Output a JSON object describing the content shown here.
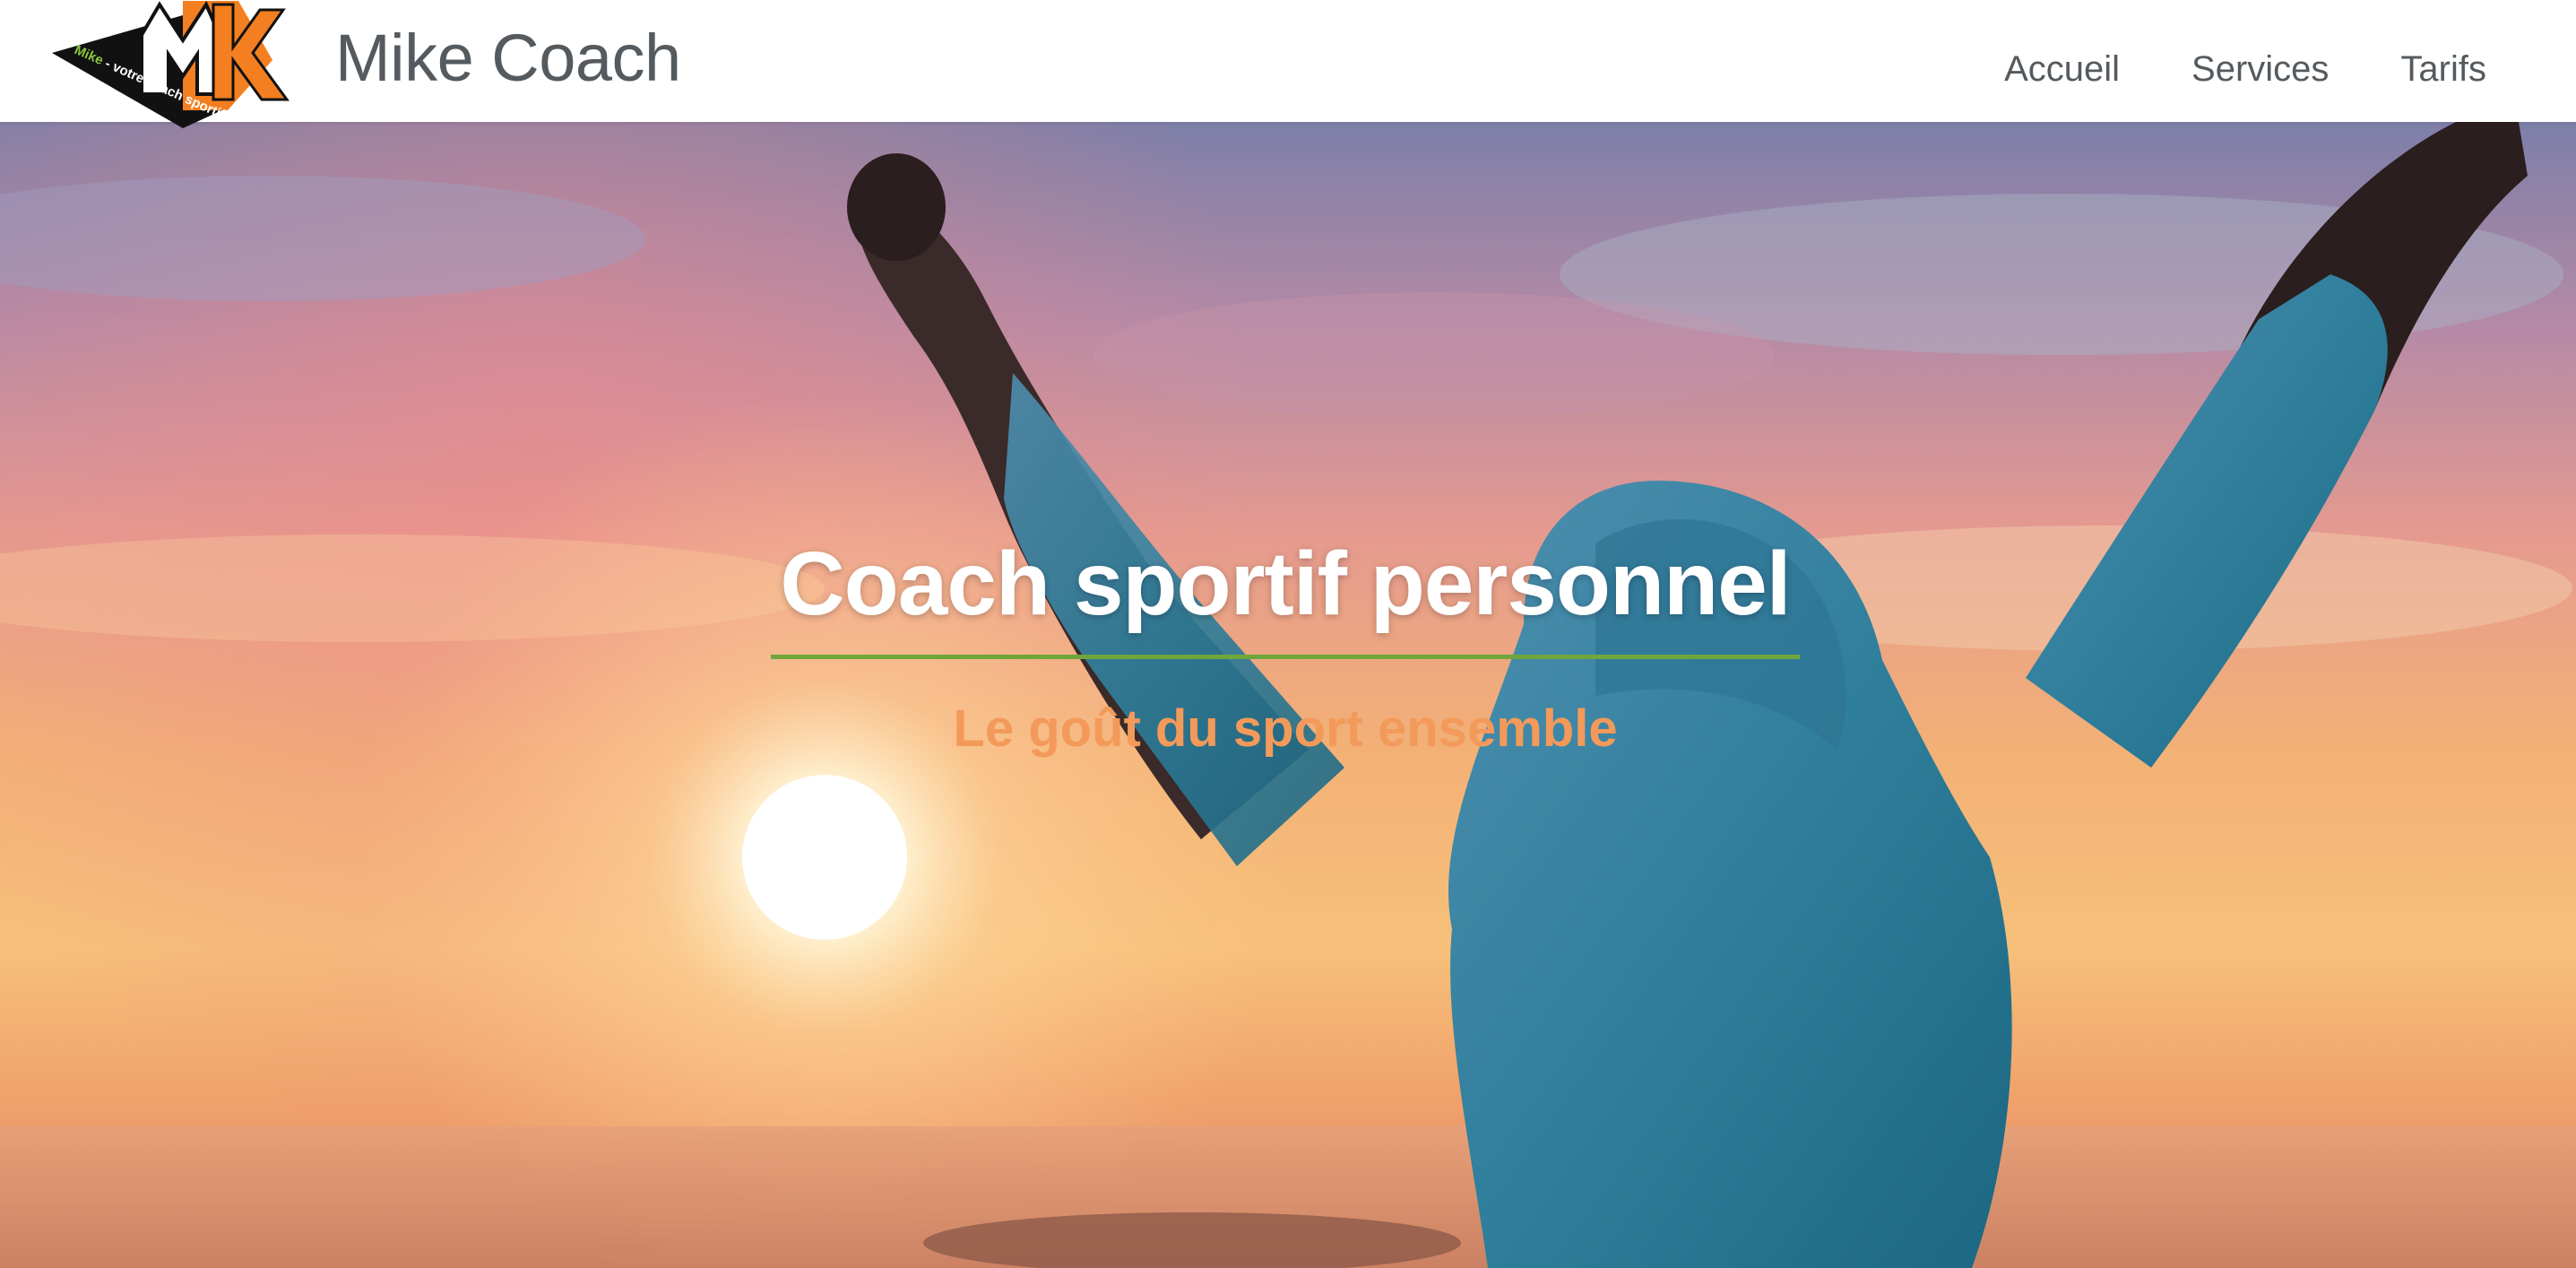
{
  "header": {
    "brand_name": "Mike Coach",
    "logo": {
      "icon": "mk-logo-icon",
      "letters": "MK",
      "tagline_highlight": "Mike",
      "tagline_rest": " - votre coach sportif",
      "accent_color": "#f37f20",
      "highlight_color": "#8dc63f"
    },
    "nav": [
      {
        "label": "Accueil"
      },
      {
        "label": "Services"
      },
      {
        "label": "Tarifs"
      }
    ]
  },
  "hero": {
    "title": "Coach sportif personnel",
    "subtitle": "Le goût du sport ensemble",
    "subtitle_color": "#f39a5a",
    "rule_color": "#6fa63a",
    "background": "sunset-athlete-photo"
  }
}
